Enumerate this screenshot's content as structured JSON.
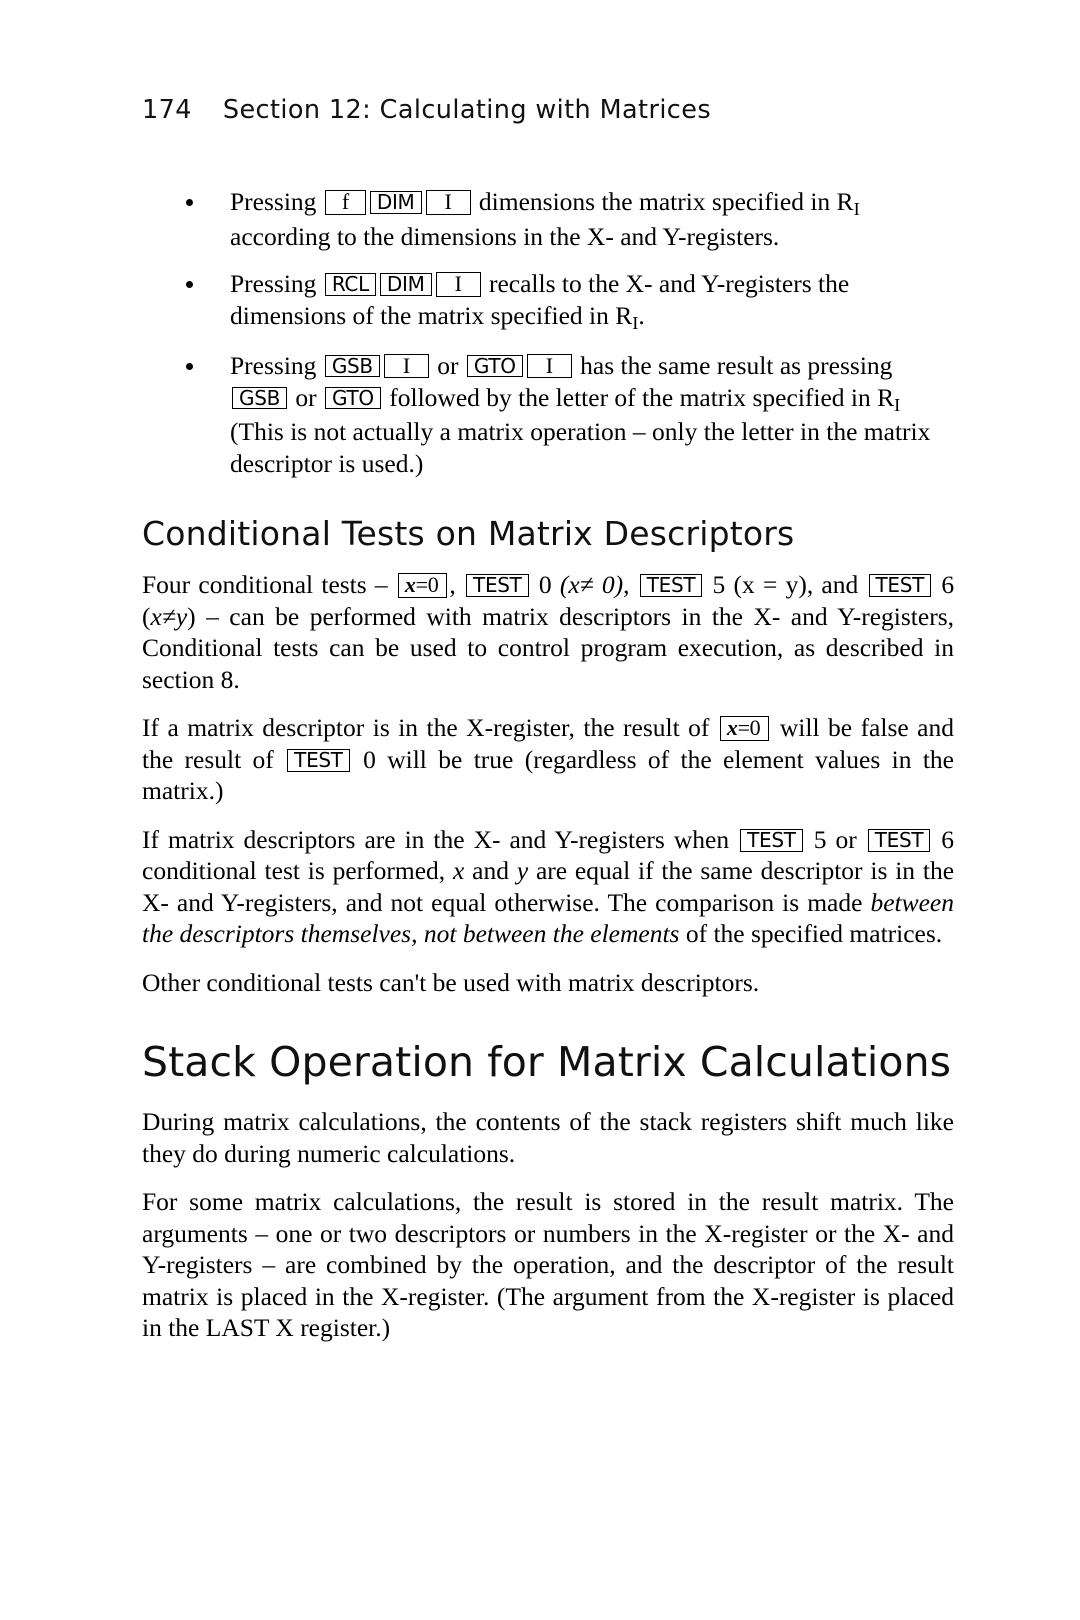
{
  "header": {
    "folio": "174",
    "title": "Section 12: Calculating with Matrices"
  },
  "bullets": [
    {
      "text_before": "Pressing",
      "keys": [
        "f",
        "DIM",
        "I"
      ],
      "text_after_1": "dimensions the matrix specified in R",
      "sub_1": "I",
      "text_after_2": "according to the dimensions in the X- and Y-registers."
    },
    {
      "text_before": "Pressing",
      "keys": [
        "RCL",
        "DIM",
        "I"
      ],
      "text_after_1": "recalls to the X- and Y-registers the",
      "text_after_2": "dimensions of the matrix specified in R",
      "sub_1": "I",
      "text_after_3": "."
    },
    {
      "text_before": "Pressing",
      "key_gsb": "GSB",
      "key_i1": "I",
      "or_1": "or",
      "key_gto": "GTO",
      "key_i2": "I",
      "text_mid_1": "has the same result as pressing",
      "key_gsb2": "GSB",
      "or_2": "or",
      "key_gto2": "GTO",
      "text_mid_2": "followed by the letter of the matrix specified in R",
      "sub_1": "I",
      "text_end": "(This is not actually a matrix operation – only the letter in the matrix descriptor is used.)"
    }
  ],
  "section_heading": "Conditional Tests on Matrix Descriptors",
  "paragraph_1": {
    "p1": "Four conditional tests –",
    "key_xeq0_x": "x",
    "key_xeq0_rest": "=0",
    "p2": ",",
    "key_test_1": "TEST",
    "p3": "0",
    "p3_italic": "(x≠ 0)",
    "p3b": ",",
    "key_test_2": "TEST",
    "p4": "5 (x = y), and",
    "key_test_3": "TEST",
    "p5_num": "6 (",
    "p5_italic": "x≠y",
    "p5_rest": ") – can be performed with matrix descriptors in the X- and Y-registers, Conditional tests can be used to control program execution, as described in section 8."
  },
  "paragraph_2": {
    "p1": "If a matrix descriptor is in the X-register, the result of",
    "key_xeq0_x": "x",
    "key_xeq0_rest": "=0",
    "p2": "will be false and the result of",
    "key_test": "TEST",
    "p3": "0 will be true (regardless of the element values in the matrix.)"
  },
  "paragraph_3": {
    "p1": "If matrix descriptors are in the X- and Y-registers when",
    "key_test_1": "TEST",
    "p2": "5 or",
    "key_test_2": "TEST",
    "p3": "6 conditional test is performed,",
    "it_x": "x",
    "p4": "and",
    "it_y": "y",
    "p5": "are equal if the same descriptor is in the X- and Y-registers, and not equal otherwise. The comparison is made",
    "italic_phrase": "between the descriptors themselves, not between the elements",
    "p6": "of the specified matrices."
  },
  "paragraph_4": "Other conditional tests can't be used with matrix descriptors.",
  "major_heading": "Stack Operation for Matrix Calculations",
  "paragraph_5": "During matrix calculations, the contents of the stack registers shift much like they do during numeric calculations.",
  "paragraph_6": "For some matrix calculations, the result is stored in the result matrix. The arguments – one or two descriptors or numbers in the X-register or the X- and Y-registers – are combined by the operation, and the descriptor of the result matrix is placed in the X-register. (The argument from the X-register is placed in the LAST X register.)",
  "colors": {
    "text": "#000000",
    "page_background": "#ffffff",
    "heading": "#111111"
  }
}
